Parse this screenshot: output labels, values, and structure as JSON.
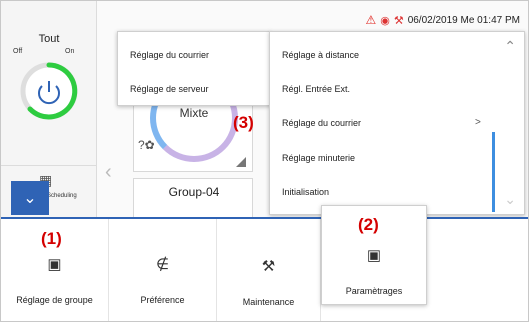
{
  "left_panel": {
    "title": "Tout",
    "off_label": "Off",
    "on_label": "On",
    "power_icon": "power-icon",
    "schedule_label": "Scheduling",
    "collapse_icon": "chevron-down-icon"
  },
  "status_bar": {
    "datetime": "06/02/2019 Me 01:47 PM",
    "warning_icon": "warning-triangle-icon",
    "alert_color": "#e0201a"
  },
  "cards": {
    "mixte_label": "Mixte",
    "group_label": "Group-04",
    "fan_icon": "fan-icon"
  },
  "annotations": {
    "one": "(1)",
    "two": "(2)",
    "three": "(3)"
  },
  "menu_left": {
    "items": [
      "Réglage du courrier",
      "Réglage de serveur"
    ]
  },
  "menu_right": {
    "items": [
      "Réglage à distance",
      "Régl. Entrée Ext.",
      "Réglage du courrier",
      "Réglage minuterie",
      "Initialisation"
    ],
    "submenu_arrow": ">"
  },
  "toolbar": {
    "group_label": "Réglage de groupe",
    "preference_label": "Préférence",
    "maintenance_label": "Maintenance",
    "settings_label": "Paramètrages"
  },
  "colors": {
    "accent": "#2f63b5",
    "annotation": "#d40000",
    "power_ring": "#2ecc40"
  }
}
